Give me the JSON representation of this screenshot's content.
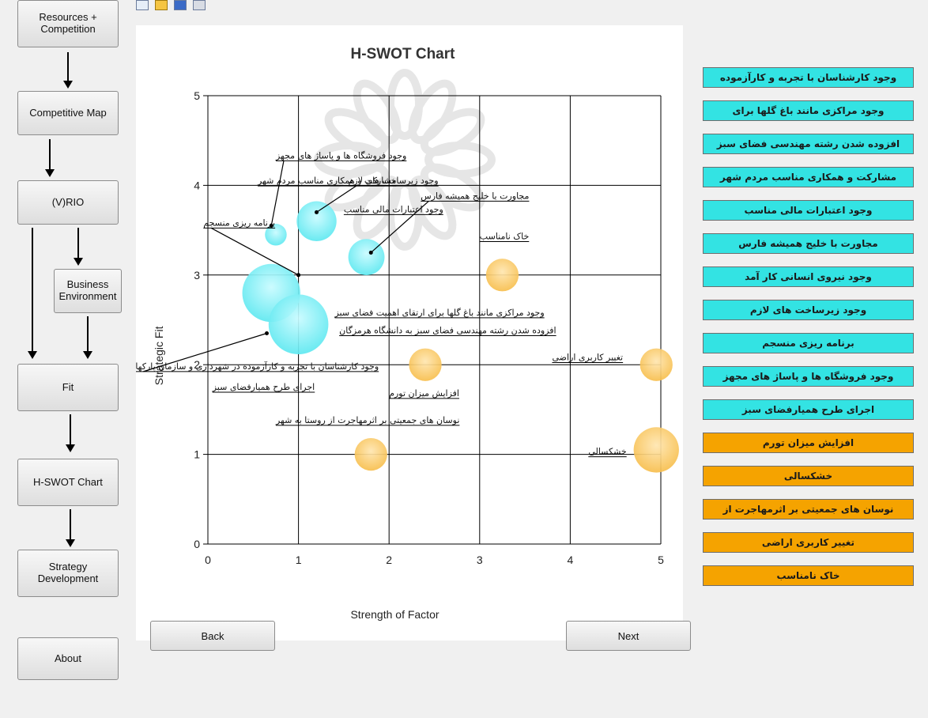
{
  "nav": {
    "resources": "Resources +\nCompetition",
    "competitive_map": "Competitive Map",
    "vrio": "(V)RIO",
    "business_env": "Business\nEnvironment",
    "fit": "Fit",
    "hswot": "H-SWOT Chart",
    "strategy": "Strategy\nDevelopment",
    "about": "About"
  },
  "bottom": {
    "back": "Back",
    "next": "Next"
  },
  "toolbar_icons": [
    "new-icon",
    "open-icon",
    "save-icon",
    "print-icon"
  ],
  "factors": [
    {
      "label": "وجود کارشناسان با تجربه و کارآزموده",
      "kind": "strength"
    },
    {
      "label": "وجود مراکزی مانند باغ گلها برای",
      "kind": "strength"
    },
    {
      "label": "افزوده شدن رشته مهندسی فضای سبز",
      "kind": "strength"
    },
    {
      "label": "مشارکت و همکاری مناسب مردم شهر",
      "kind": "strength"
    },
    {
      "label": "وجود اعتبارات مالی مناسب",
      "kind": "strength"
    },
    {
      "label": "مجاورت با خلیج همیشه فارس",
      "kind": "strength"
    },
    {
      "label": "وجود نیروی انسانی کار آمد",
      "kind": "strength"
    },
    {
      "label": "وجود زیرساخت های لازم",
      "kind": "strength"
    },
    {
      "label": "برنامه ریزی منسجم",
      "kind": "strength"
    },
    {
      "label": "وجود فروشگاه ها و پاساژ های مجهز",
      "kind": "strength"
    },
    {
      "label": "اجرای طرح همیارفضای سبز",
      "kind": "strength"
    },
    {
      "label": "افزایش میزان تورم",
      "kind": "threat"
    },
    {
      "label": "خشکسالی",
      "kind": "threat"
    },
    {
      "label": "نوسان های جمعیتی بر اثرمهاجرت از",
      "kind": "threat"
    },
    {
      "label": "تغییر کاربری اراضی",
      "kind": "threat"
    },
    {
      "label": "خاک نامناسب",
      "kind": "threat"
    }
  ],
  "colors": {
    "strength": "#33e3e3",
    "threat": "#f5a300",
    "bubble_strength": "#5de8f0",
    "bubble_threat": "#f7be4c"
  },
  "chart_data": {
    "type": "scatter",
    "title": "H-SWOT Chart",
    "xlabel": "Strength of Factor",
    "ylabel": "Strategic Fit",
    "xlim": [
      0,
      5
    ],
    "ylim": [
      0,
      5
    ],
    "xticks": [
      "0",
      "1",
      "2",
      "3",
      "4",
      "5"
    ],
    "yticks": [
      "0",
      "1",
      "2",
      "3",
      "4",
      "5"
    ],
    "grid": true,
    "points": [
      {
        "x": 0.75,
        "y": 3.45,
        "r": 0.12,
        "kind": "strength"
      },
      {
        "x": 1.2,
        "y": 3.6,
        "r": 0.22,
        "kind": "strength"
      },
      {
        "x": 1.75,
        "y": 3.2,
        "r": 0.2,
        "kind": "strength"
      },
      {
        "x": 0.7,
        "y": 2.8,
        "r": 0.32,
        "kind": "strength"
      },
      {
        "x": 1.0,
        "y": 2.45,
        "r": 0.33,
        "kind": "strength"
      },
      {
        "x": 3.25,
        "y": 3.0,
        "r": 0.18,
        "kind": "threat"
      },
      {
        "x": 2.4,
        "y": 2.0,
        "r": 0.18,
        "kind": "threat"
      },
      {
        "x": 4.95,
        "y": 2.0,
        "r": 0.18,
        "kind": "threat"
      },
      {
        "x": 1.8,
        "y": 1.0,
        "r": 0.18,
        "kind": "threat"
      },
      {
        "x": 4.95,
        "y": 1.05,
        "r": 0.25,
        "kind": "threat"
      }
    ],
    "annotations": [
      {
        "text": "وجود فروشگاه ها و پاساژ های مجهز",
        "x": 0.75,
        "y": 4.3,
        "tx": 0.7,
        "ty": 3.55
      },
      {
        "text": "وجود زیرساخت های لازم",
        "x": 1.55,
        "y": 4.02,
        "tx": 1.2,
        "ty": 3.7
      },
      {
        "text": "مشارکت و همکاری مناسب مردم شهر",
        "x": 0.55,
        "y": 4.02
      },
      {
        "text": "مجاورت با خلیج همیشه فارس",
        "x": 2.35,
        "y": 3.85,
        "tx": 1.8,
        "ty": 3.25
      },
      {
        "text": "وجود اعتبارات مالی مناسب",
        "x": 1.5,
        "y": 3.7
      },
      {
        "text": "برنامه ریزی منسجم",
        "x": -0.05,
        "y": 3.55,
        "tx": 1.0,
        "ty": 3.0
      },
      {
        "text": "خاک نامناسب",
        "x": 3.0,
        "y": 3.4
      },
      {
        "text": "وجود مراکزی مانند باغ گلها برای ارتقای اهمیت فضای سبز",
        "x": 1.4,
        "y": 2.55
      },
      {
        "text": "افزوده شدن رشته مهندسی فضای سبز به دانشگاه هرمزگان",
        "x": 1.45,
        "y": 2.35
      },
      {
        "text": "تغییر کاربری اراضی",
        "x": 3.8,
        "y": 2.05
      },
      {
        "text": "وجود کارشناسان با تجربه و کارآزموده در شهرداری و سازمان پارکها",
        "x": -0.8,
        "y": 1.95,
        "tx": 0.65,
        "ty": 2.35
      },
      {
        "text": "اجرای طرح همیارفضای سبز",
        "x": 0.05,
        "y": 1.72
      },
      {
        "text": "افزایش میزان تورم",
        "x": 2.0,
        "y": 1.65
      },
      {
        "text": "نوسان های جمعیتی بر اثرمهاجرت از روستا به شهر",
        "x": 0.75,
        "y": 1.35
      },
      {
        "text": "خشکسالی",
        "x": 4.2,
        "y": 1.0
      }
    ]
  }
}
